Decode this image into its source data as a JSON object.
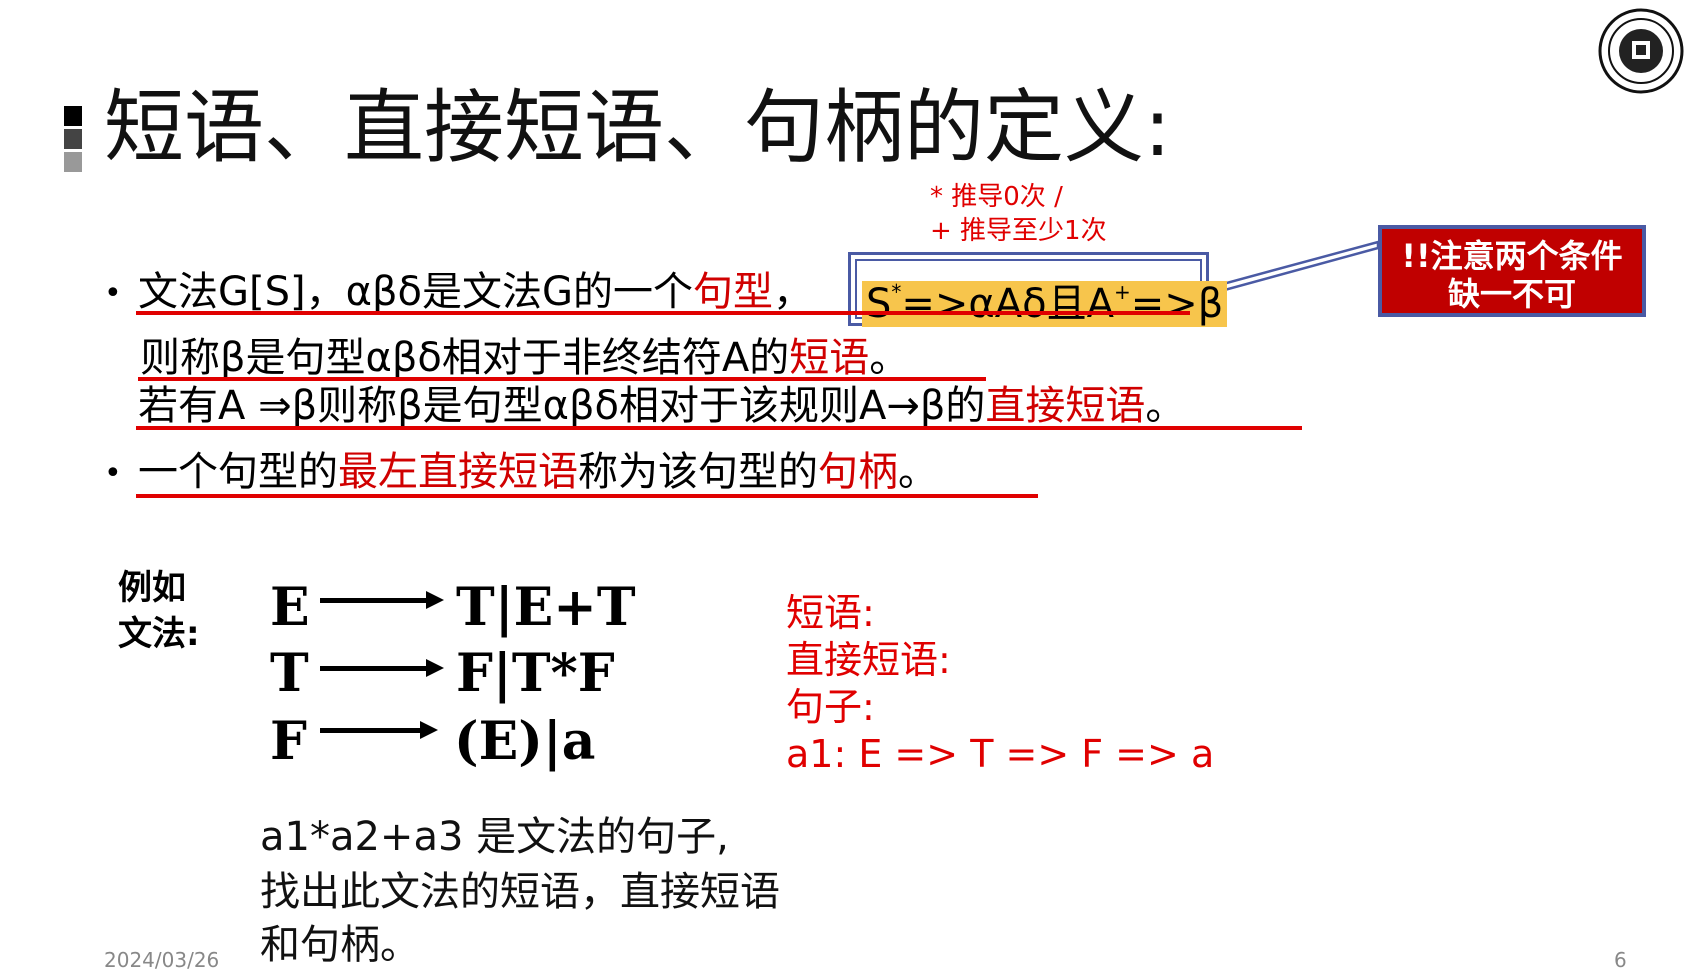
{
  "slide": {
    "title": "短语、直接短语、句柄的定义:",
    "date": "2024/03/26",
    "page_number": "6",
    "logo_icon": "university-seal-icon"
  },
  "note": {
    "line1": "*  推导0次 /",
    "line2": "+ 推导至少1次"
  },
  "callout": {
    "line1": "!!注意两个条件",
    "line2": "缺一不可"
  },
  "definitions": {
    "bullet": "•",
    "line1_a": "文法G[S]，αβδ是文法G的一个",
    "line1_em": "句型",
    "line1_b": "，",
    "formula": "S⇒*αAδ且A⇒+β",
    "formula_s": "S",
    "formula_star": "*",
    "formula_mid": "=>αAδ且A",
    "formula_plus": "+",
    "formula_end": "=>β",
    "line2_a": "则称β是句型αβδ相对于非终结符A的",
    "line2_em": "短语",
    "line2_b": "。",
    "line3_a": "若有A ⇒β则称β是句型αβδ相对于该规则A→β的",
    "line3_em": "直接短语",
    "line3_b": "。",
    "line4_a": "一个句型的",
    "line4_em1": "最左直接短语",
    "line4_b": "称为该句型的",
    "line4_em2": "句柄",
    "line4_c": "。"
  },
  "example": {
    "label_line1": "例如",
    "label_line2": "文法:",
    "rules": [
      {
        "lhs": "E",
        "rhs": "T|E+T"
      },
      {
        "lhs": "T",
        "rhs": "F|T*F"
      },
      {
        "lhs": "F",
        "rhs": "(E)|a"
      }
    ],
    "task_line1": "a1*a2+a3 是文法的句子,",
    "task_line2": "找出此文法的短语，直接短语",
    "task_line3": "和句柄。"
  },
  "answers": {
    "phrase": "短语:",
    "direct_phrase": "直接短语:",
    "sentence": "句子:",
    "derivation": "a1:  E => T =>  F => a"
  },
  "colors": {
    "emphasis": "#d00000",
    "highlight": "#f7c54c",
    "box_border": "#4a5aa4",
    "callout_bg": "#c00000"
  }
}
